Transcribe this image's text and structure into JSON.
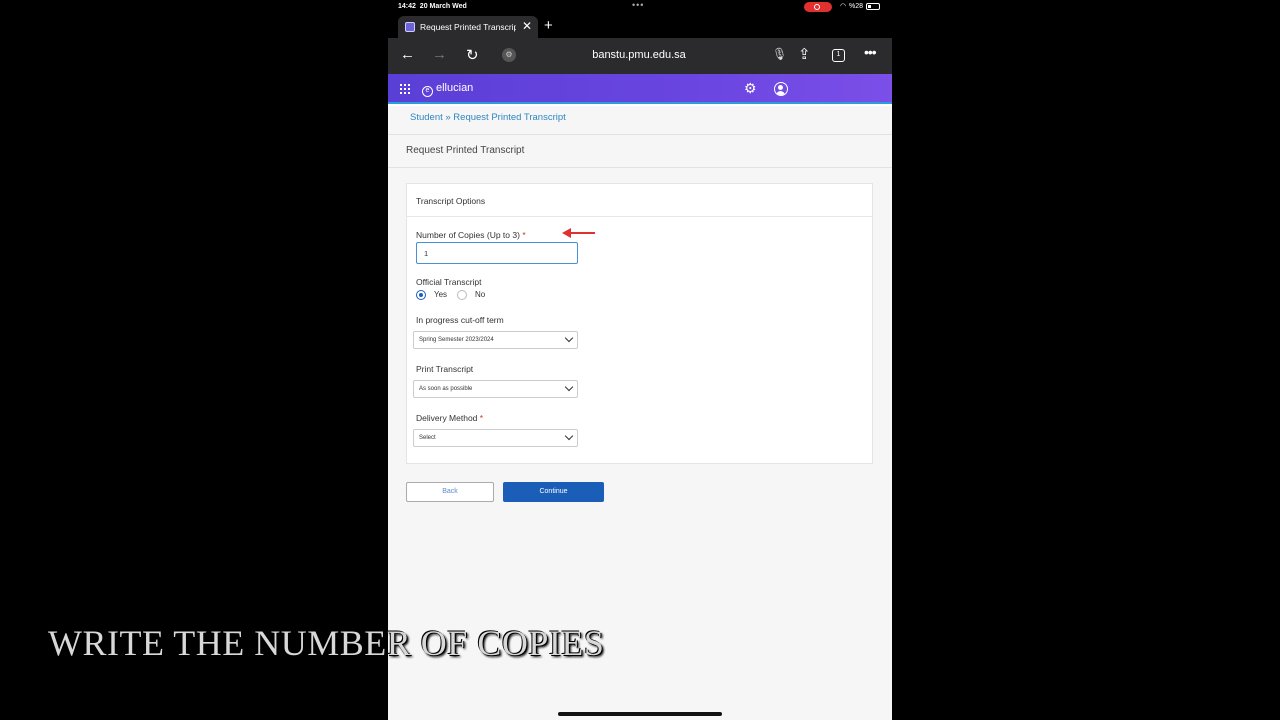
{
  "status_bar": {
    "time": "14:42",
    "date": "20 March Wed",
    "battery": "%28"
  },
  "browser": {
    "tab_title": "Request Printed Transcript",
    "url": "banstu.pmu.edu.sa",
    "tab_count": "1"
  },
  "app": {
    "brand": "ellucian"
  },
  "breadcrumb": "Student » Request Printed Transcript",
  "page_title": "Request Printed Transcript",
  "form": {
    "section_title": "Transcript Options",
    "copies_label": "Number of Copies (Up to 3)",
    "copies_value": "1",
    "official_label": "Official Transcript",
    "official_yes": "Yes",
    "official_no": "No",
    "cutoff_label": "In progress cut-off term",
    "cutoff_value": "Spring Semester 2023/2024",
    "print_label": "Print Transcript",
    "print_value": "As soon as possible",
    "delivery_label": "Delivery Method",
    "delivery_value": "Select",
    "required_mark": "*"
  },
  "buttons": {
    "back": "Back",
    "continue": "Continue"
  },
  "caption": "WRITE THE NUMBER OF COPIES",
  "colors": {
    "header": "#6a45e0",
    "primary": "#1a5eb8",
    "link": "#2e86c1",
    "required": "#c0392b",
    "arrow": "#e0302f"
  }
}
